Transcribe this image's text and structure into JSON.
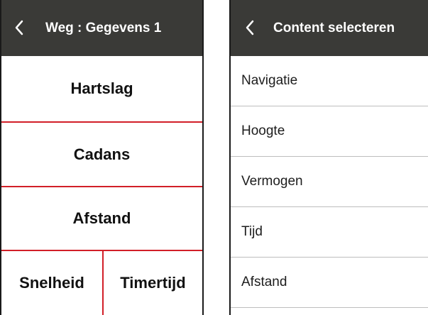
{
  "left_screen": {
    "title": "Weg : Gegevens 1",
    "fields": {
      "row1": "Hartslag",
      "row2": "Cadans",
      "row3": "Afstand",
      "row4_left": "Snelheid",
      "row4_right": "Timertijd"
    }
  },
  "right_screen": {
    "title": "Content selecteren",
    "items": [
      {
        "label": "Navigatie"
      },
      {
        "label": "Hoogte"
      },
      {
        "label": "Vermogen"
      },
      {
        "label": "Tijd"
      },
      {
        "label": "Afstand"
      }
    ]
  },
  "colors": {
    "header_bg": "#3a3a37",
    "accent_red": "#d21f28",
    "list_divider": "#bdbdbd"
  },
  "icons": {
    "back": "chevron-left-icon"
  }
}
